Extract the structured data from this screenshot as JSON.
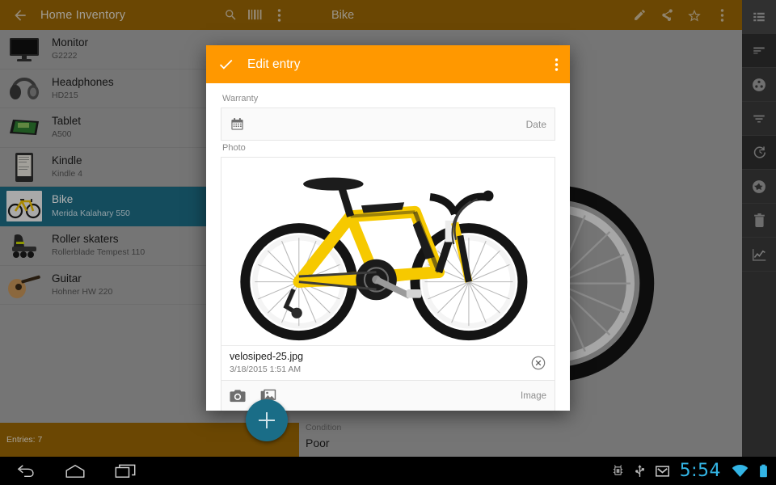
{
  "app": {
    "left_header": {
      "back_icon": "back-arrow-icon",
      "title": "Home Inventory",
      "search_icon": "search-icon",
      "barcode_icon": "barcode-icon",
      "overflow_icon": "overflow-menu-icon"
    },
    "inventory_items": [
      {
        "name": "Monitor",
        "model": "G2222",
        "thumb": "monitor-thumb",
        "selected": false
      },
      {
        "name": "Headphones",
        "model": "HD215",
        "thumb": "headphones-thumb",
        "selected": false
      },
      {
        "name": "Tablet",
        "model": "A500",
        "thumb": "tablet-thumb",
        "selected": false
      },
      {
        "name": "Kindle",
        "model": "Kindle 4",
        "thumb": "kindle-thumb",
        "selected": false
      },
      {
        "name": "Bike",
        "model": "Merida Kalahary 550",
        "thumb": "bike-thumb",
        "selected": true
      },
      {
        "name": "Roller skaters",
        "model": "Rollerblade Tempest 110",
        "thumb": "skates-thumb",
        "selected": false
      },
      {
        "name": "Guitar",
        "model": "Hohner HW 220",
        "thumb": "guitar-thumb",
        "selected": false
      }
    ],
    "footer": {
      "entries_label": "Entries: 7"
    },
    "fab": {
      "icon": "add-icon"
    },
    "detail_header": {
      "title": "Bike",
      "edit_icon": "pencil-edit-icon",
      "share_icon": "share-icon",
      "star_icon": "star-outline-icon",
      "overflow_icon": "overflow-menu-icon"
    },
    "detail_fields": {
      "condition_label": "Condition",
      "condition_value": "Poor"
    },
    "rail_items": [
      {
        "icon": "list-view-icon",
        "state": "active"
      },
      {
        "icon": "sort-lines-icon",
        "state": "normal"
      },
      {
        "icon": "category-circle-icon",
        "state": "normal"
      },
      {
        "icon": "filter-icon",
        "state": "normal"
      },
      {
        "icon": "history-icon",
        "state": "normal"
      },
      {
        "icon": "star-circle-icon",
        "state": "normal"
      },
      {
        "icon": "delete-trash-icon",
        "state": "normal"
      },
      {
        "icon": "chart-line-icon",
        "state": "normal"
      }
    ]
  },
  "dialog": {
    "confirm_icon": "checkmark-icon",
    "title": "Edit entry",
    "overflow_icon": "overflow-menu-icon",
    "warranty": {
      "label": "Warranty",
      "calendar_icon": "calendar-icon",
      "value": "",
      "hint": "Date"
    },
    "photo": {
      "label": "Photo",
      "file_name": "velosiped-25.jpg",
      "file_date": "3/18/2015 1:51 AM",
      "clear_icon": "clear-circle-icon",
      "camera_icon": "camera-icon",
      "gallery_icon": "gallery-icon",
      "hint": "Image"
    }
  },
  "system_bar": {
    "back_icon": "nav-back-icon",
    "home_icon": "nav-home-icon",
    "recents_icon": "nav-recents-icon",
    "android_icon": "android-debug-icon",
    "usb_icon": "usb-icon",
    "mail_icon": "gmail-icon",
    "clock": "5:54",
    "wifi_icon": "wifi-icon",
    "battery_icon": "battery-icon"
  },
  "colors": {
    "app_bar": "#9a6605",
    "dialog_header": "#ff9800",
    "accent_teal": "#1e6e86",
    "status_blue": "#33b5e5",
    "surface": "#a8a8a8"
  }
}
